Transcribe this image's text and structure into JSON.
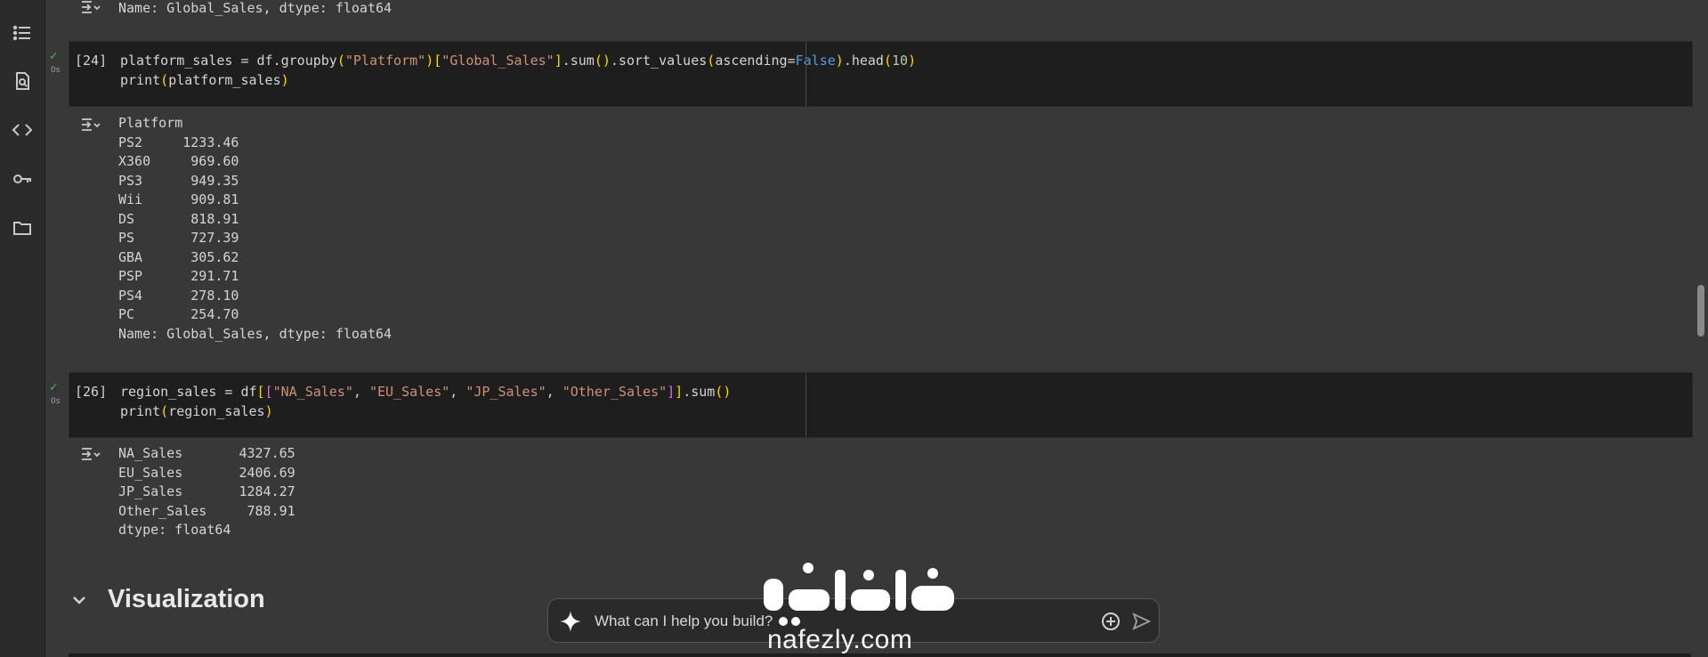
{
  "sidebar": {
    "icons": [
      "table-of-contents-icon",
      "find-icon",
      "code-snippets-icon",
      "secrets-key-icon",
      "files-folder-icon"
    ]
  },
  "top_output": {
    "line": "Name: Global_Sales, dtype: float64"
  },
  "cell_24": {
    "status": "✓",
    "time": "0s",
    "exec_count": "[24]",
    "code": [
      "platform_sales = df.groupby(\"Platform\")[\"Global_Sales\"].sum().sort_values(ascending=False).head(10)",
      "print(platform_sales)"
    ],
    "output": [
      "Platform",
      "PS2     1233.46",
      "X360     969.60",
      "PS3      949.35",
      "Wii      909.81",
      "DS       818.91",
      "PS       727.39",
      "GBA      305.62",
      "PSP      291.71",
      "PS4      278.10",
      "PC       254.70",
      "Name: Global_Sales, dtype: float64"
    ]
  },
  "cell_26": {
    "status": "✓",
    "time": "0s",
    "exec_count": "[26]",
    "code": [
      "region_sales = df[[\"NA_Sales\", \"EU_Sales\", \"JP_Sales\", \"Other_Sales\"]].sum()",
      "print(region_sales)"
    ],
    "output": [
      "NA_Sales       4327.65",
      "EU_Sales       2406.69",
      "JP_Sales       1284.27",
      "Other_Sales     788.91",
      "dtype: float64"
    ]
  },
  "section": {
    "title": "Visualization"
  },
  "chat": {
    "placeholder": "What can I help you build?"
  },
  "watermark": {
    "arabic": "نفذلي",
    "latin": "nafezly.com"
  },
  "colors": {
    "background": "#383838",
    "cell_bg": "#1e1e1e",
    "string": "#ce9178",
    "keyword": "#569cd6",
    "number": "#b5cea8",
    "bracket_yellow": "#ffd700",
    "bracket_purple": "#da70d6",
    "success": "#4caf50"
  }
}
